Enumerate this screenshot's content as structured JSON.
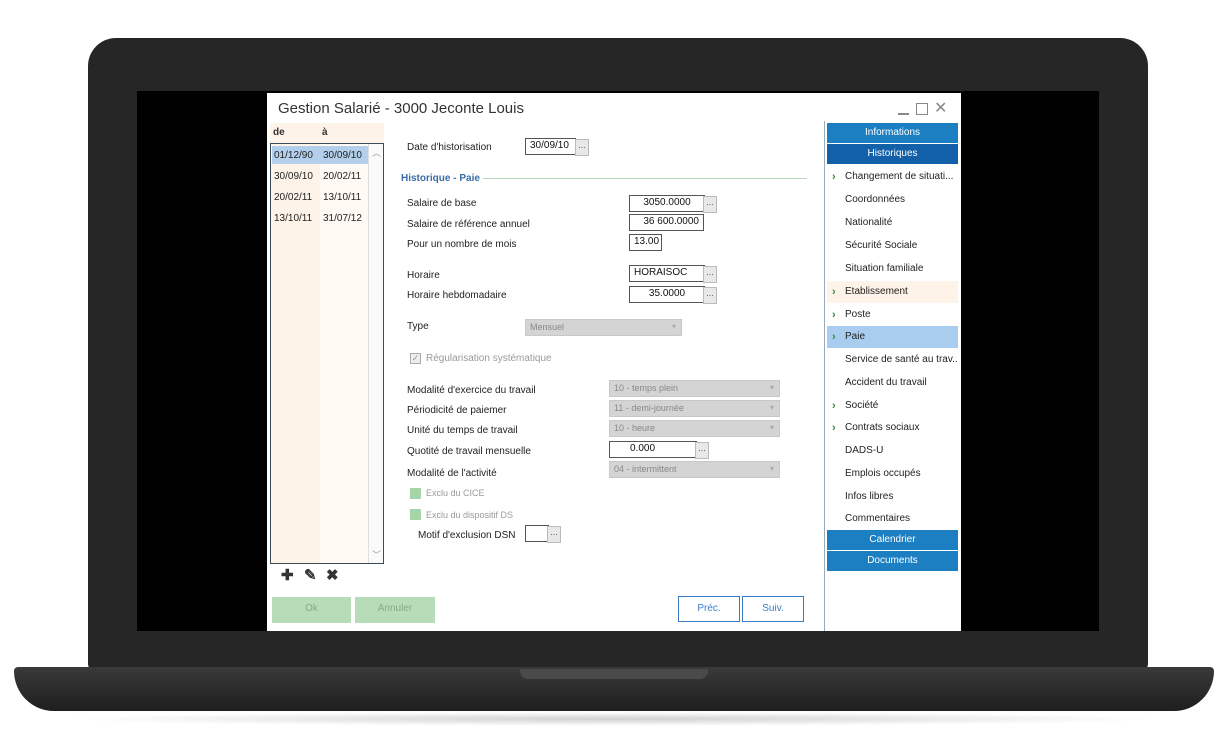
{
  "window": {
    "title": "Gestion Salarié - 3000 Jeconte Louis"
  },
  "history": {
    "col_from": "de",
    "col_to": "à",
    "rows": [
      {
        "from": "01/12/90",
        "to": "30/09/10",
        "selected": true
      },
      {
        "from": "30/09/10",
        "to": "20/02/11"
      },
      {
        "from": "20/02/11",
        "to": "13/10/11"
      },
      {
        "from": "13/10/11",
        "to": "31/07/12"
      }
    ]
  },
  "form": {
    "date_label": "Date d'historisation",
    "date_value": "30/09/10",
    "section_title": "Historique - Paie",
    "salaire_base_label": "Salaire de base",
    "salaire_base_value": "3050.0000",
    "salaire_ref_label": "Salaire de référence annuel",
    "salaire_ref_value": "36 600.0000",
    "nb_mois_label": "Pour un nombre de mois",
    "nb_mois_value": "13.00",
    "horaire_label": "Horaire",
    "horaire_value": "HORAISOC",
    "horaire_hebdo_label": "Horaire hebdomadaire",
    "horaire_hebdo_value": "35.0000",
    "type_label": "Type",
    "type_value": "Mensuel",
    "regularisation_label": "Régularisation systématique",
    "modalite_exercice_label": "Modalité d'exercice du travail",
    "modalite_exercice_value": "10 - temps plein",
    "periodicite_label": "Périodicité de paiemer",
    "periodicite_value": "11 - demi-journée",
    "unite_label": "Unité du temps de travail",
    "unite_value": "10 - heure",
    "quotite_label": "Quotité de travail mensuelle",
    "quotite_value": "0.000",
    "modalite_activite_label": "Modalité de l'activité",
    "modalite_activite_value": "04 - intermittent",
    "exclu_cice_label": "Exclu du CICE",
    "exclu_ds_label": "Exclu du dispositif DS",
    "motif_label": "Motif d'exclusion DSN",
    "motif_value": "",
    "dots": "..."
  },
  "buttons": {
    "ok": "Ok",
    "cancel": "Annuler",
    "prev": "Préc.",
    "next": "Suiv."
  },
  "nav": {
    "head_info": "Informations",
    "head_hist": "Historiques",
    "items": [
      {
        "label": "Changement de situati...",
        "arrow": true
      },
      {
        "label": "Coordonnées"
      },
      {
        "label": "Nationalité"
      },
      {
        "label": "Sécurité Sociale"
      },
      {
        "label": "Situation familiale"
      },
      {
        "label": "Etablissement",
        "arrow": true
      },
      {
        "label": "Poste",
        "arrow": true
      },
      {
        "label": "Paie",
        "arrow": true
      },
      {
        "label": "Service de santé au trav..."
      },
      {
        "label": "Accident du travail"
      },
      {
        "label": "Société",
        "arrow": true
      },
      {
        "label": "Contrats sociaux",
        "arrow": true
      },
      {
        "label": "DADS-U"
      },
      {
        "label": "Emplois occupés"
      },
      {
        "label": "Infos libres"
      },
      {
        "label": "Commentaires"
      }
    ],
    "head_cal": "Calendrier",
    "head_docs": "Documents"
  },
  "icons": {
    "add": "plus-icon",
    "edit": "pencil-icon",
    "delete": "x-icon",
    "chevron": "chevron-right-icon",
    "check": "check-icon"
  },
  "colors": {
    "nav_header": "#1c7fc2",
    "nav_active": "#a9cdef",
    "section_title": "#3a6ea8",
    "disabled_green": "#b8dcb8"
  }
}
